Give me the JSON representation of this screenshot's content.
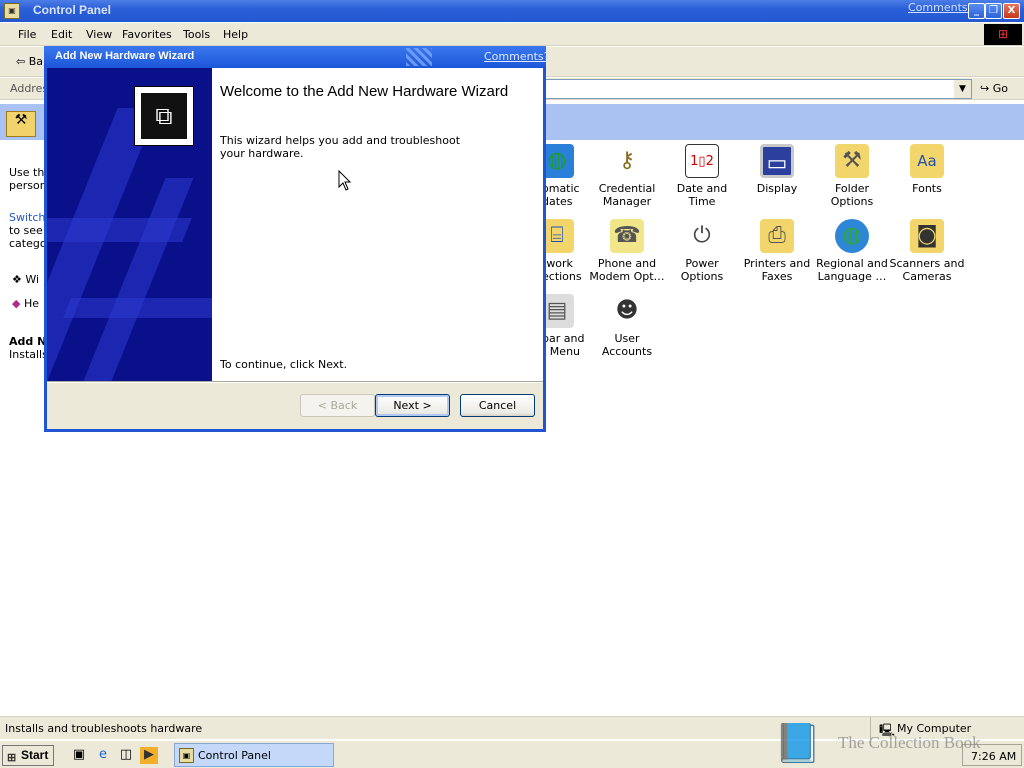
{
  "window": {
    "title": "Control Panel",
    "comments_link": "Comments?",
    "controls": {
      "minimize": "_",
      "restore": "❐",
      "close": "X"
    }
  },
  "menubar": {
    "items": [
      "File",
      "Edit",
      "View",
      "Favorites",
      "Tools",
      "Help"
    ]
  },
  "toolbar": {
    "back_label": "⇦ Ba"
  },
  "addressbar": {
    "label": "Addres",
    "go_label": "Go"
  },
  "left_pane": {
    "lines": [
      {
        "text": "Use the",
        "style": "plain"
      },
      {
        "text": "person",
        "style": "plain"
      },
      {
        "text": "Switch",
        "style": "link"
      },
      {
        "text": "to see i",
        "style": "plain"
      },
      {
        "text": "catego",
        "style": "plain"
      },
      {
        "text": "Wi",
        "style": "plain"
      },
      {
        "text": "He",
        "style": "plain"
      },
      {
        "text": "Add Ne",
        "style": "bold"
      },
      {
        "text": "Installs",
        "style": "plain"
      }
    ]
  },
  "icons": [
    {
      "label": "omatic\ndates",
      "icon": "globe-update-icon"
    },
    {
      "label": "Credential\nManager",
      "icon": "keys-icon"
    },
    {
      "label": "Date and Time",
      "icon": "calendar-clock-icon"
    },
    {
      "label": "Display",
      "icon": "monitor-icon"
    },
    {
      "label": "Folder Options",
      "icon": "folder-options-icon"
    },
    {
      "label": "Fonts",
      "icon": "fonts-folder-icon"
    },
    {
      "label": "twork\nections",
      "icon": "network-icon"
    },
    {
      "label": "Phone and\nModem Opt…",
      "icon": "phone-icon"
    },
    {
      "label": "Power Options",
      "icon": "power-icon"
    },
    {
      "label": "Printers and\nFaxes",
      "icon": "printer-icon"
    },
    {
      "label": "Regional and\nLanguage …",
      "icon": "globe-icon"
    },
    {
      "label": "Scanners and\nCameras",
      "icon": "camera-icon"
    },
    {
      "label": "bar and\nt Menu",
      "icon": "taskbar-icon"
    },
    {
      "label": "User Accounts",
      "icon": "users-icon"
    }
  ],
  "statusbar": {
    "text": "Installs and troubleshoots hardware",
    "zone": "My Computer"
  },
  "taskbar": {
    "start_label": "Start",
    "task_label": "Control Panel",
    "clock": "7:26 AM"
  },
  "watermark": "The Collection Book",
  "wizard": {
    "title": "Add New Hardware Wizard",
    "comments_link": "Comments?",
    "heading": "Welcome to the Add New Hardware Wizard",
    "description": "This wizard helps you add and troubleshoot your hardware.",
    "continue_text": "To continue, click Next.",
    "buttons": {
      "back": "< Back",
      "next": "Next >",
      "cancel": "Cancel"
    }
  }
}
